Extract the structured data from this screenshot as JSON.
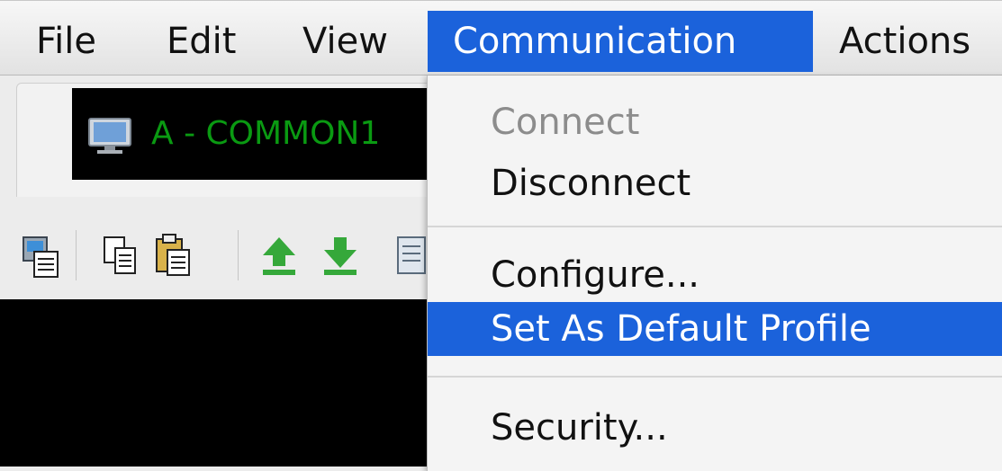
{
  "menubar": {
    "items": [
      {
        "label": "File"
      },
      {
        "label": "Edit"
      },
      {
        "label": "View"
      },
      {
        "label": "Communication",
        "active": true
      },
      {
        "label": "Actions"
      }
    ]
  },
  "session": {
    "tab_label": "A - COMMON1",
    "label_color": "#0a9a12",
    "icon": "monitor-icon"
  },
  "toolbar": {
    "icons": [
      "copy-special-icon",
      "copy-icon",
      "paste-icon",
      "upload-icon",
      "download-icon",
      "document-icon"
    ]
  },
  "dropdown": {
    "items": [
      {
        "label": "Connect",
        "disabled": true
      },
      {
        "label": "Disconnect"
      },
      {
        "label": "Configure..."
      },
      {
        "label": "Set As Default Profile",
        "selected": true
      },
      {
        "label": "Security..."
      }
    ]
  },
  "colors": {
    "accent": "#1b62db",
    "terminal_bg": "#000000"
  }
}
